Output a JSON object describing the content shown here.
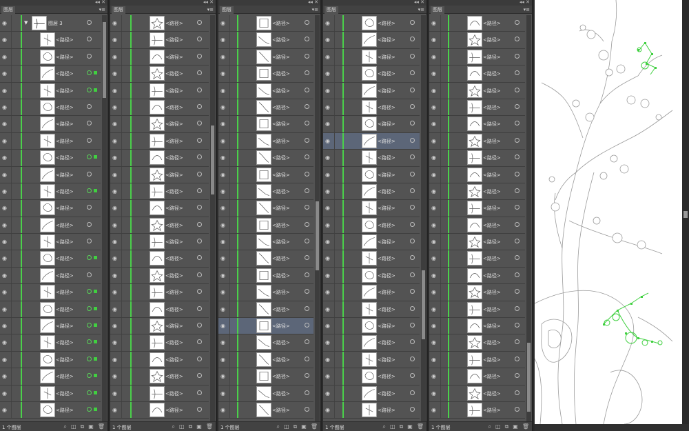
{
  "panel_tab_label": "图层",
  "panel_menu_glyph": "▾≡",
  "panel_top_controls": "◂◂ ✕",
  "layer_name": "图层 3",
  "row_label": "<路径>",
  "footer_text": "1 个图层",
  "colors": {
    "panel_bg": "#535353",
    "selected_row": "#5c6678",
    "layer_color_line": "#4ad14a",
    "canvas_bg": "#ffffff",
    "selection_highlight": "#40d040"
  },
  "icons": {
    "visibility": "eye-icon",
    "target": "target-circle-icon",
    "selected_art": "selection-square-icon",
    "expand": "disclosure-triangle-icon",
    "footer": [
      "search-icon",
      "make-clipping-mask-icon",
      "new-sublayer-icon",
      "new-layer-icon",
      "delete-icon"
    ]
  }
}
